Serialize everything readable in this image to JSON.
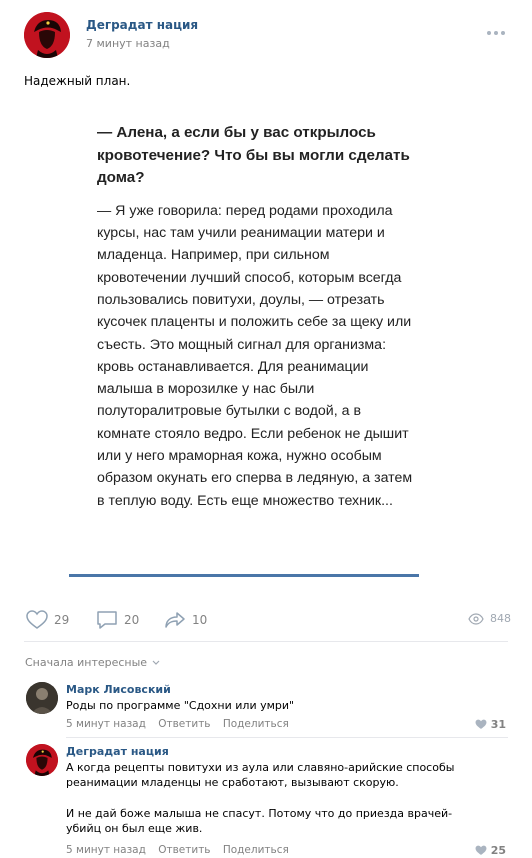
{
  "post": {
    "author": "Деградат нация",
    "time": "7 минут назад",
    "text": "Надежный план.",
    "more_icon": "ellipsis-icon",
    "image_text": {
      "question": "— Алена, а если бы у вас открылось кровотечение? Что бы вы могли сделать дома?",
      "answer": "— Я уже говорила: перед родами проходила курсы, нас там учили реанимации матери и младенца. Например, при сильном кровотечении лучший способ, которым всегда пользовались повитухи, доулы, — отрезать кусочек плаценты и положить себе за щеку или съесть. Это мощный сигнал для организма: кровь останавливается. Для реанимации малыша в морозилке у нас были полуторалитровые бутылки с водой, а в комнате стояло ведро. Если ребенок не дышит или у него мраморная кожа, нужно особым образом окунать его сперва в ледяную, а затем в теплую воду. Есть еще множество техник..."
    },
    "likes": "29",
    "comments": "20",
    "shares": "10",
    "views": "848"
  },
  "comments_section": {
    "sort_label": "Сначала интересные",
    "items": [
      {
        "author": "Марк Лисовский",
        "text": "Роды по программе \"Сдохни или умри\"",
        "time": "5 минут назад",
        "reply": "Ответить",
        "share": "Поделиться",
        "likes": "31"
      },
      {
        "author": "Деградат нация",
        "text1": "А когда рецепты повитухи из аула или славяно-арийские способы реанимации младенцы не сработают, вызывают скорую.",
        "text2": "И не дай боже малыша не спасут. Потому что до приезда врачей-убийц он был еще жив.",
        "time": "5 минут назад",
        "reply": "Ответить",
        "share": "Поделиться",
        "likes": "25"
      }
    ]
  },
  "colors": {
    "link": "#2a5885",
    "accent": "#4a76a8",
    "muted": "#828282",
    "avatar_red": "#c1121f"
  }
}
